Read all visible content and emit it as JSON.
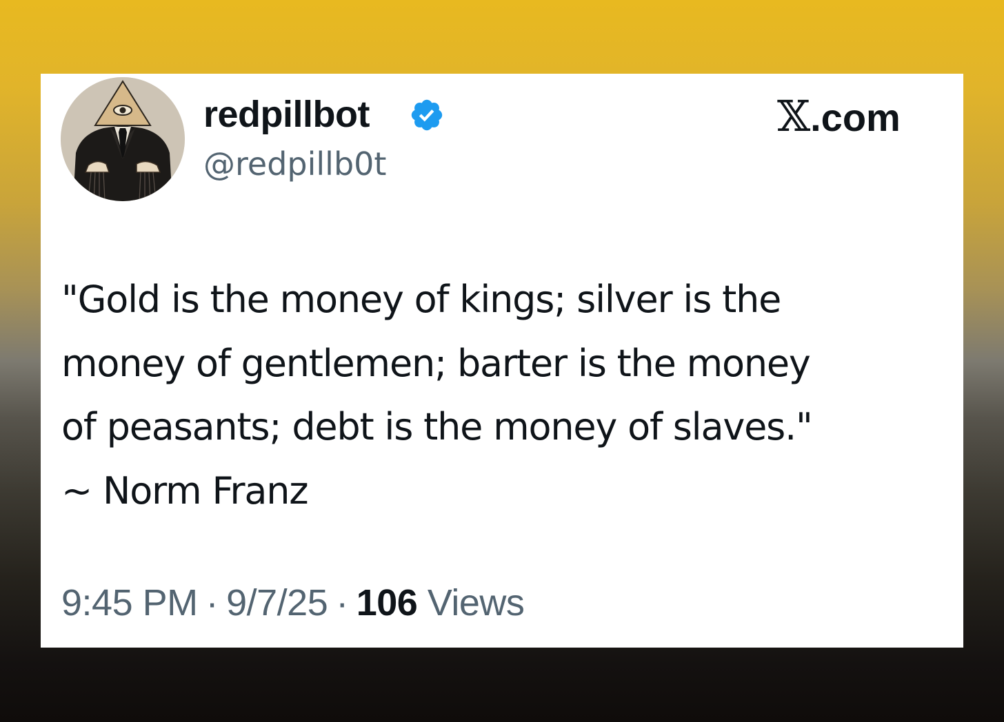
{
  "tweet": {
    "display_name": "redpillbot",
    "handle": "@redpillb0t",
    "brand": {
      "glyph": "𝕏",
      "suffix": ".com"
    },
    "text_lines": [
      "\"Gold is the money of kings; silver is the",
      "money of gentlemen; barter is the money",
      "of peasants; debt is the money of slaves.\"",
      "~ Norm Franz"
    ],
    "time": "9:45 PM",
    "separator": "·",
    "date": "9/7/25",
    "views_count": "106",
    "views_label": "Views"
  },
  "icons": {
    "verified": "verified-badge-icon",
    "avatar": "illuminati-eye-pyramid-puppet-master"
  },
  "colors": {
    "card_background": "#ffffff",
    "primary_text": "#0f1419",
    "secondary_text": "#536471",
    "verified_blue": "#1d9bf0",
    "background_top": "#e8b920",
    "background_bottom": "#0f0c0a"
  }
}
